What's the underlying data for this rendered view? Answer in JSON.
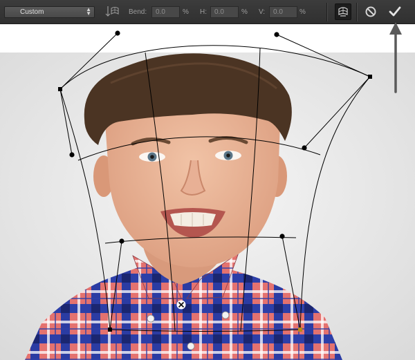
{
  "options_bar": {
    "warp_preset": {
      "value": "Custom"
    },
    "warp_orientation_icon": "change-warp-orientation-icon",
    "bend": {
      "label": "Bend:",
      "value": "0.0",
      "unit": "%"
    },
    "horizontal": {
      "label": "H:",
      "value": "0.0",
      "unit": "%"
    },
    "vertical": {
      "label": "V:",
      "value": "0.0",
      "unit": "%"
    },
    "toggle_icon": "warp-mode-toggle-icon",
    "cancel_icon": "cancel-icon",
    "commit_icon": "checkmark-icon"
  },
  "colors": {
    "toolbar_bg": "#333333",
    "field_bg": "#484848",
    "text_label": "#9c9c9c",
    "text_value": "#e2e2e2",
    "warp_line": "#000000",
    "handle_point": "#000000",
    "annotation_arrow": "#555555"
  }
}
